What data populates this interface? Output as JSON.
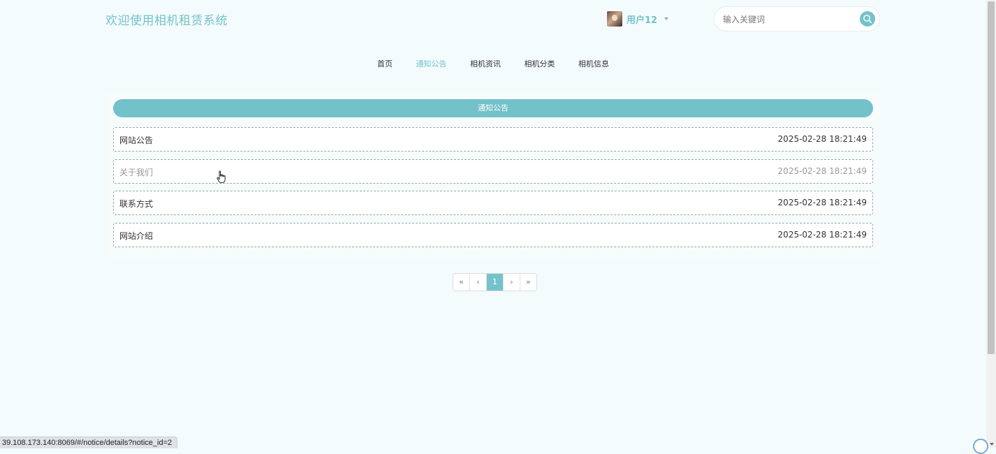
{
  "header": {
    "site_title": "欢迎使用相机租赁系统",
    "user_name": "用户12",
    "search_placeholder": "输入关键词"
  },
  "nav": {
    "items": [
      {
        "label": "首页",
        "active": false
      },
      {
        "label": "通知公告",
        "active": true
      },
      {
        "label": "相机资讯",
        "active": false
      },
      {
        "label": "相机分类",
        "active": false
      },
      {
        "label": "相机信息",
        "active": false
      }
    ]
  },
  "notice_panel": {
    "heading": "通知公告",
    "rows": [
      {
        "title": "网站公告",
        "time": "2025-02-28 18:21:49"
      },
      {
        "title": "关于我们",
        "time": "2025-02-28 18:21:49"
      },
      {
        "title": "联系方式",
        "time": "2025-02-28 18:21:49"
      },
      {
        "title": "网站介绍",
        "time": "2025-02-28 18:21:49"
      }
    ]
  },
  "pagination": {
    "first": "«",
    "prev": "‹",
    "current": "1",
    "next": "›",
    "last": "»"
  },
  "status_bar": {
    "url": "39.108.173.140:8069/#/notice/details?notice_id=2"
  },
  "icons": {
    "search": "search-icon",
    "caret": "caret-down-icon",
    "cursor": "hand-pointer-icon"
  },
  "colors": {
    "accent": "#74c2cb",
    "background": "#f4fbfd"
  }
}
